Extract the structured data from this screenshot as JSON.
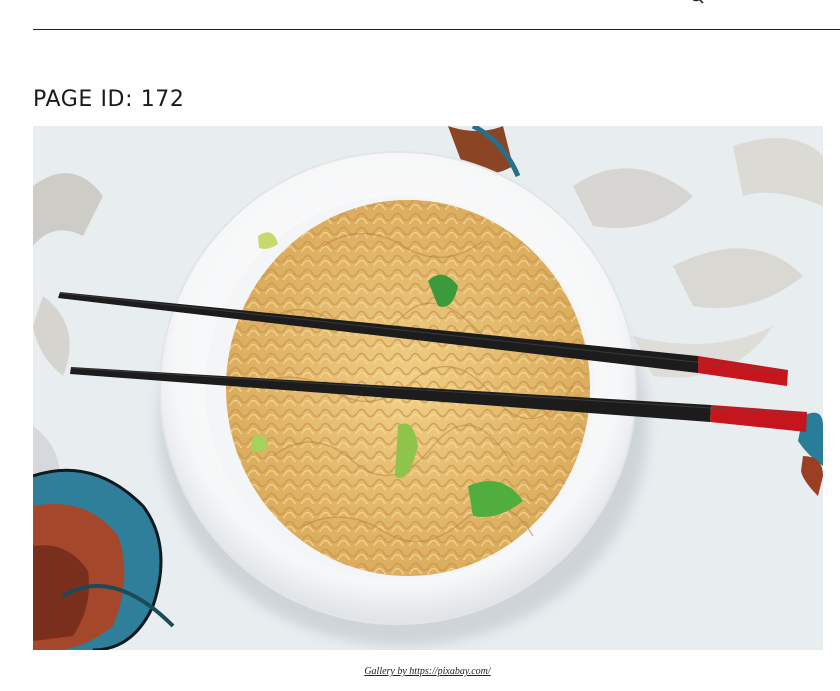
{
  "header": {
    "search_icon": "search-icon"
  },
  "page": {
    "title": "PAGE ID: 172"
  },
  "image": {
    "subject": "bowl-of-noodles-with-chopsticks"
  },
  "caption": {
    "text": "Gallery by https://pixabay.com/"
  },
  "colors": {
    "rule": "#222222",
    "title": "#1a1a1a",
    "chopstick_black": "#1c1c1c",
    "chopstick_red": "#c4161c",
    "noodle": "#e9c47a",
    "bowl": "#ffffff"
  }
}
